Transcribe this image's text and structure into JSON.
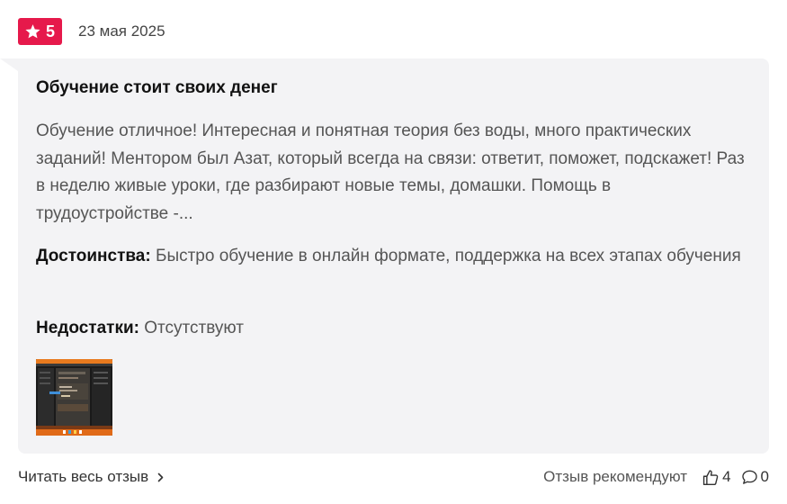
{
  "review": {
    "rating": "5",
    "date": "23 мая 2025",
    "title": "Обучение стоит своих денег",
    "body": "Обучение отличное! Интересная и понятная теория без воды, много практических заданий! Ментором был Азат, который всегда на связи: ответит, поможет, подскажет! Раз в неделю живые уроки, где разбирают новые темы, домашки. Помощь в трудоустройстве -...",
    "pros_label": "Достоинства:",
    "pros_text": "Быстро обучение в онлайн формате, поддержка на всех этапах обучения",
    "cons_label": "Недостатки:",
    "cons_text": "Отсутствуют"
  },
  "footer": {
    "read_full": "Читать весь отзыв",
    "recommend_label": "Отзыв рекомендуют",
    "likes": "4",
    "comments": "0"
  },
  "icons": {
    "rating": "star-icon",
    "read_more": "chevron-right-icon",
    "like": "thumb-up-icon",
    "comment": "comment-icon"
  },
  "colors": {
    "badge": "#e6194b",
    "card_background": "#f3f3f5"
  }
}
